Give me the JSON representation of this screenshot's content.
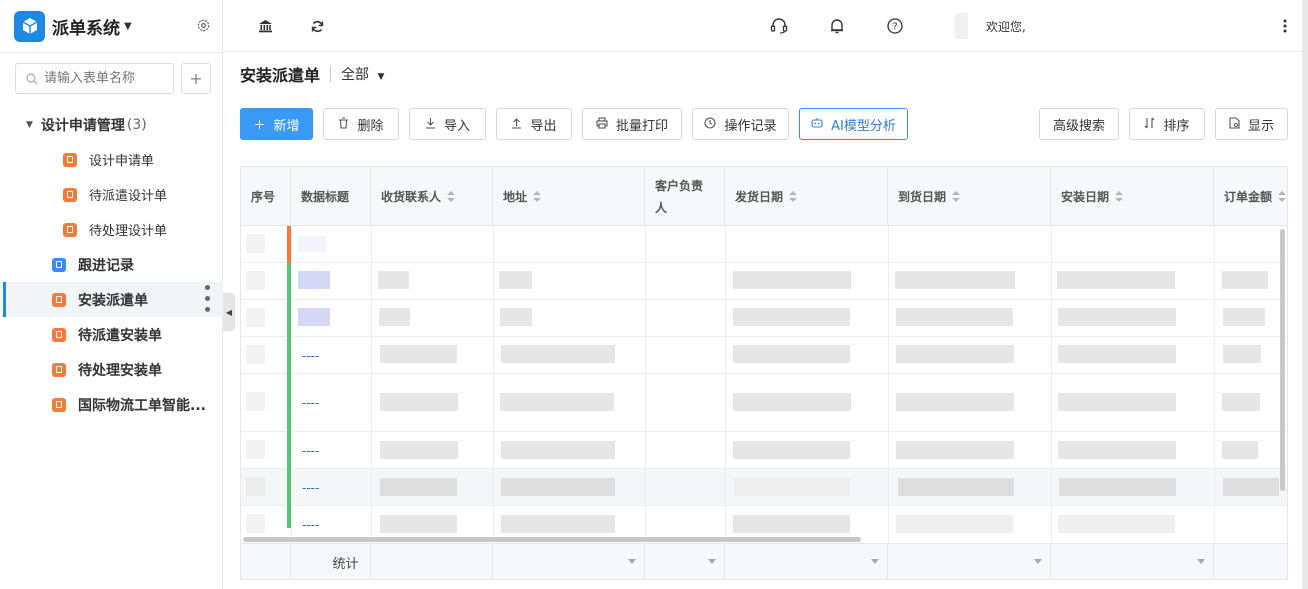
{
  "app": {
    "title": "派单系统"
  },
  "sidebar": {
    "search_placeholder": "请输入表单名称",
    "group": {
      "label": "设计申请管理",
      "count": "(3)"
    },
    "sub_items": [
      {
        "label": "设计申请单"
      },
      {
        "label": "待派遣设计单"
      },
      {
        "label": "待处理设计单"
      }
    ],
    "items": [
      {
        "label": "跟进记录",
        "icon_color": "#3d8af7"
      },
      {
        "label": "安装派遣单",
        "icon_color": "#f47b3c",
        "active": true
      },
      {
        "label": "待派遣安装单",
        "icon_color": "#f47b3c"
      },
      {
        "label": "待处理安装单",
        "icon_color": "#f47b3c"
      },
      {
        "label": "国际物流工单智能...",
        "icon_color": "#f47b3c"
      }
    ]
  },
  "topbar": {
    "icons": [
      "bank-icon",
      "refresh-icon",
      "headset-icon",
      "bell-icon",
      "help-icon",
      "more-icon"
    ],
    "welcome": "欢迎您,"
  },
  "page": {
    "title": "安装派遣单",
    "filter": "全部"
  },
  "toolbar": {
    "add": "新增",
    "delete": "删除",
    "import": "导入",
    "export": "导出",
    "batch_print": "批量打印",
    "op_log": "操作记录",
    "ai": "AI模型分析",
    "advanced_search": "高级搜索",
    "sort": "排序",
    "display": "显示"
  },
  "table": {
    "columns": [
      "序号",
      "数据标题",
      "收货联系人",
      "地址",
      "客户负责人",
      "发货日期",
      "到货日期",
      "安装日期",
      "订单金额"
    ],
    "rows_title_values": [
      "",
      "",
      "",
      "----",
      "----",
      "----",
      "----",
      "----"
    ],
    "footer_label": "统计"
  },
  "colors": {
    "primary": "#3a99f5",
    "accent_orange": "#f47b3c",
    "accent_green": "#5cc27a"
  }
}
